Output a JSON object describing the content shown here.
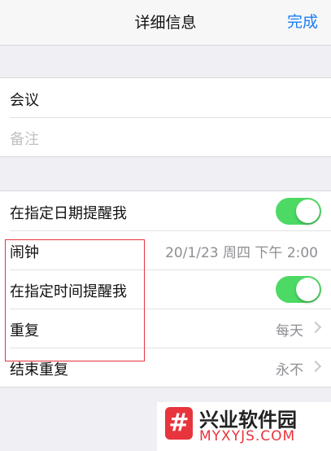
{
  "navbar": {
    "title": "详细信息",
    "done_label": "完成"
  },
  "title_group": {
    "title_value": "会议",
    "notes_placeholder": "备注"
  },
  "reminder_group": {
    "remind_on_day_label": "在指定日期提醒我",
    "remind_on_day_enabled": true,
    "alarm_label": "闹钟",
    "alarm_value": "20/1/23 周四 下午 2:00",
    "remind_at_time_label": "在指定时间提醒我",
    "remind_at_time_enabled": true,
    "repeat_label": "重复",
    "repeat_value": "每天",
    "end_repeat_label": "结束重复",
    "end_repeat_value": "永不"
  },
  "watermark": {
    "name": "兴业软件园",
    "url": "MYXYJS.COM",
    "logo_glyph": "#"
  },
  "colors": {
    "accent": "#1b7cf6",
    "toggle_on": "#4cd964",
    "highlight": "#e8343c",
    "background": "#efeff4"
  }
}
